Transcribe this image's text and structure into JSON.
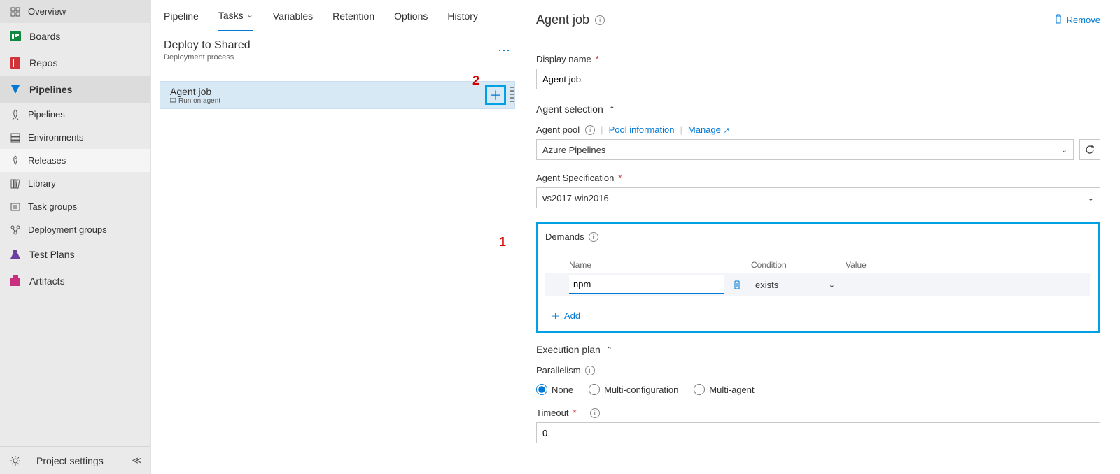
{
  "sidebar": {
    "overview": "Overview",
    "boards": "Boards",
    "repos": "Repos",
    "pipelines": "Pipelines",
    "sub_pipelines": "Pipelines",
    "environments": "Environments",
    "releases": "Releases",
    "library": "Library",
    "task_groups": "Task groups",
    "deployment_groups": "Deployment groups",
    "test_plans": "Test Plans",
    "artifacts": "Artifacts",
    "project_settings": "Project settings"
  },
  "tabs": {
    "pipeline": "Pipeline",
    "tasks": "Tasks",
    "variables": "Variables",
    "retention": "Retention",
    "options": "Options",
    "history": "History"
  },
  "stage": {
    "title": "Deploy to Shared",
    "subtitle": "Deployment process"
  },
  "job": {
    "title": "Agent job",
    "subtitle": "Run on agent"
  },
  "details": {
    "heading": "Agent job",
    "remove": "Remove",
    "display_name_label": "Display name",
    "display_name_value": "Agent job",
    "agent_selection": "Agent selection",
    "agent_pool_label": "Agent pool",
    "pool_info": "Pool information",
    "manage": "Manage",
    "agent_pool_value": "Azure Pipelines",
    "agent_spec_label": "Agent Specification",
    "agent_spec_value": "vs2017-win2016",
    "demands_label": "Demands",
    "demands_cols": {
      "name": "Name",
      "cond": "Condition",
      "value": "Value"
    },
    "demand_name": "npm",
    "demand_cond": "exists",
    "add": "Add",
    "execution_plan": "Execution plan",
    "parallelism": "Parallelism",
    "radio_none": "None",
    "radio_multi_cfg": "Multi-configuration",
    "radio_multi_agent": "Multi-agent",
    "timeout_label": "Timeout",
    "timeout_value": "0"
  },
  "annotations": {
    "one": "1",
    "two": "2"
  }
}
